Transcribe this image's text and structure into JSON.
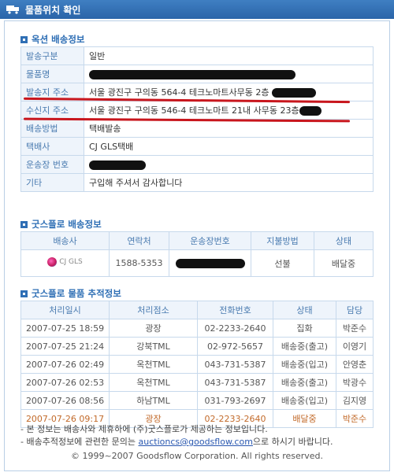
{
  "window": {
    "title": "물품위치 확인"
  },
  "shipping_info": {
    "title": "옥션 배송정보",
    "rows": [
      {
        "label": "발송구분",
        "value": "일반",
        "redacted": false
      },
      {
        "label": "물품명",
        "value": "",
        "redacted": true
      },
      {
        "label": "발송지 주소",
        "value": "서울 광진구 구의동 564-4 테크노마트사무동 2층",
        "redacted_tail": true
      },
      {
        "label": "수신지 주소",
        "value": "서울 광진구 구의동 546-4 테크노마트 21내 사무동 23층",
        "redacted_tail": true
      },
      {
        "label": "배송방법",
        "value": "택배발송",
        "redacted": false
      },
      {
        "label": "택배사",
        "value": "CJ GLS택배",
        "redacted": false
      },
      {
        "label": "운송장 번호",
        "value": "",
        "redacted": true
      },
      {
        "label": "기타",
        "value": "구입해 주셔서 감사합니다",
        "redacted": false
      }
    ]
  },
  "goodsflow_info": {
    "title": "굿스플로 배송정보",
    "headers": [
      "배송사",
      "연락처",
      "운송장번호",
      "지불방법",
      "상태"
    ],
    "row": {
      "carrier_logo": "CJ GLS",
      "contact": "1588-5353",
      "tracking": "",
      "payment": "선불",
      "status": "배달중"
    }
  },
  "tracking": {
    "title": "굿스플로 물품 추적정보",
    "headers": [
      "처리일시",
      "처리점소",
      "전화번호",
      "상태",
      "담당"
    ],
    "rows": [
      [
        "2007-07-25 18:59",
        "광장",
        "02-2233-2640",
        "집화",
        "박준수"
      ],
      [
        "2007-07-25 21:24",
        "강북TML",
        "02-972-5657",
        "배송중(출고)",
        "이영기"
      ],
      [
        "2007-07-26 02:49",
        "옥천TML",
        "043-731-5387",
        "배송중(입고)",
        "안영춘"
      ],
      [
        "2007-07-26 02:53",
        "옥천TML",
        "043-731-5387",
        "배송중(출고)",
        "박광수"
      ],
      [
        "2007-07-26 08:56",
        "하남TML",
        "031-793-2697",
        "배송중(입고)",
        "김지영"
      ],
      [
        "2007-07-26 09:17",
        "광장",
        "02-2233-2640",
        "배달중",
        "박준수"
      ]
    ]
  },
  "notes": {
    "line1": "- 본 정보는 배송사와 제휴하에 (주)굿스플로가 제공하는 정보입니다.",
    "line2_prefix": "- 배송추적정보에 관련한 문의는 ",
    "line2_link": "auctioncs@goodsflow.com",
    "line2_suffix": "으로 하시기 바랍니다.",
    "copyright": "© 1999~2007 Goodsflow Corporation. All rights reserved."
  },
  "colors": {
    "accent": "#2f6fb5",
    "label_bg": "#eef4fb",
    "border": "#c7d9ec",
    "highlight_row": "#c26a2a",
    "redline": "#c8161d"
  }
}
